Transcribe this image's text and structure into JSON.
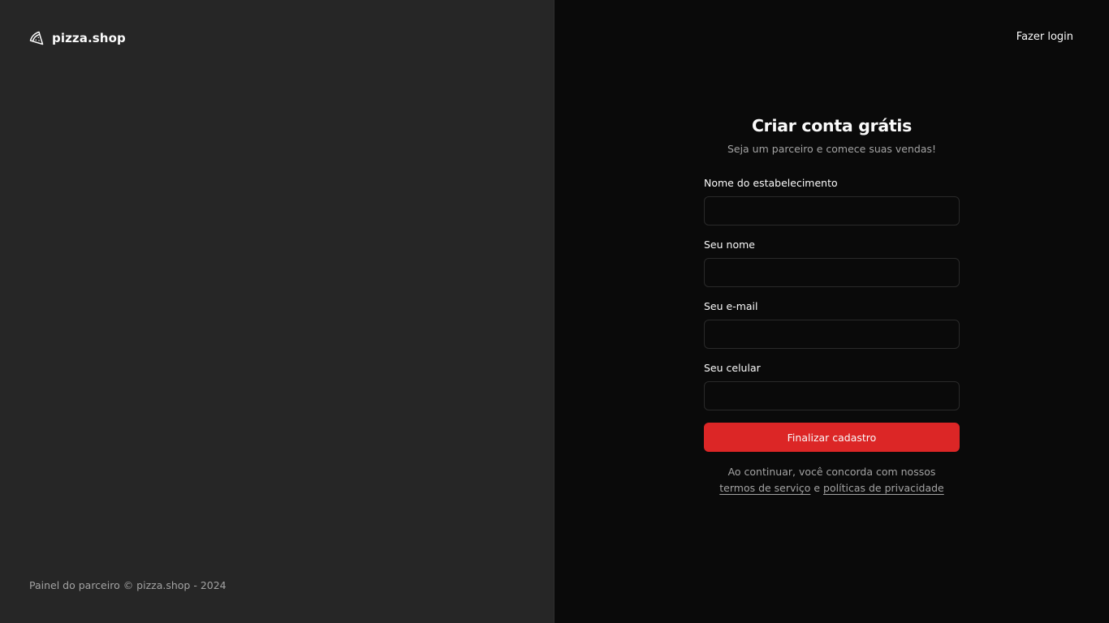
{
  "brand": {
    "icon": "pizza-slice-icon",
    "name": "pizza.shop"
  },
  "footer": {
    "text": "Painel do parceiro © pizza.shop - 2024"
  },
  "header": {
    "login_link": "Fazer login"
  },
  "signup": {
    "title": "Criar conta grátis",
    "subtitle": "Seja um parceiro e comece suas vendas!",
    "fields": [
      {
        "label": "Nome do estabelecimento",
        "value": ""
      },
      {
        "label": "Seu nome",
        "value": ""
      },
      {
        "label": "Seu e-mail",
        "value": ""
      },
      {
        "label": "Seu celular",
        "value": ""
      }
    ],
    "submit_label": "Finalizar cadastro",
    "terms": {
      "prefix": "Ao continuar, você concorda com nossos",
      "terms_link": "termos de serviço",
      "joiner": " e ",
      "privacy_link": "políticas de privacidade"
    }
  },
  "colors": {
    "left_panel_bg": "#262626",
    "right_panel_bg": "#0a0a0a",
    "accent": "#dc2626",
    "muted_text": "#a3a3a3",
    "primary_text": "#fafafa"
  }
}
